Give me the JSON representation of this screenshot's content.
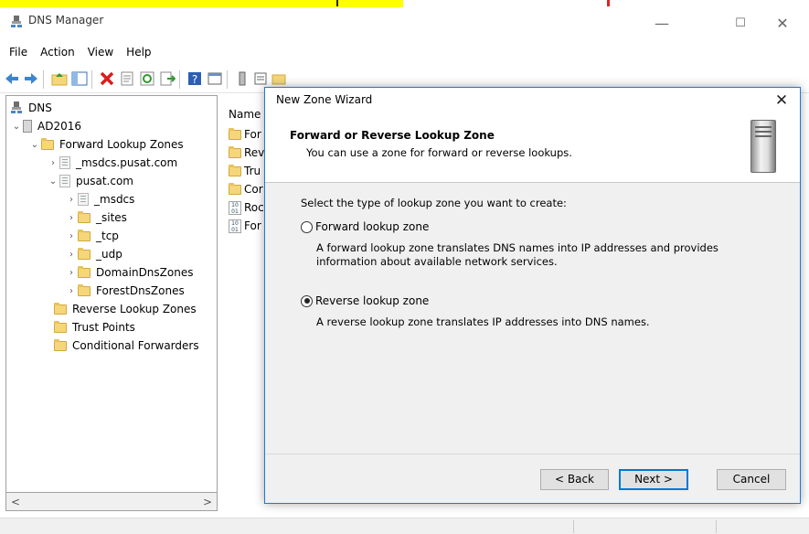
{
  "window": {
    "title": "DNS Manager",
    "minimize": "—",
    "maximize": "☐",
    "close": "✕"
  },
  "menu": [
    "File",
    "Action",
    "View",
    "Help"
  ],
  "tree": {
    "root": "DNS",
    "server": "AD2016",
    "items": [
      {
        "label": "Forward Lookup Zones"
      },
      {
        "label": "_msdcs.pusat.com"
      },
      {
        "label": "pusat.com"
      },
      {
        "label": "_msdcs"
      },
      {
        "label": "_sites"
      },
      {
        "label": "_tcp"
      },
      {
        "label": "_udp"
      },
      {
        "label": "DomainDnsZones"
      },
      {
        "label": "ForestDnsZones"
      },
      {
        "label": "Reverse Lookup Zones"
      },
      {
        "label": "Trust Points"
      },
      {
        "label": "Conditional Forwarders"
      }
    ]
  },
  "list": {
    "header": "Name",
    "rows": [
      "For",
      "Rev",
      "Tru",
      "Cor",
      "Roc",
      "For"
    ]
  },
  "wizard": {
    "title": "New Zone Wizard",
    "close": "✕",
    "heading": "Forward or Reverse Lookup Zone",
    "subheading": "You can use a zone for forward or reverse lookups.",
    "question": "Select the type of lookup zone you want to create:",
    "options": [
      {
        "label": "Forward lookup zone",
        "desc": "A forward lookup zone translates DNS names into IP addresses and provides information about available network services.",
        "selected": false
      },
      {
        "label": "Reverse lookup zone",
        "desc": "A reverse lookup zone translates IP addresses into DNS names.",
        "selected": true
      }
    ],
    "buttons": {
      "back": "< Back",
      "next": "Next >",
      "cancel": "Cancel"
    }
  },
  "scroll": {
    "left": "<",
    "right": ">"
  }
}
